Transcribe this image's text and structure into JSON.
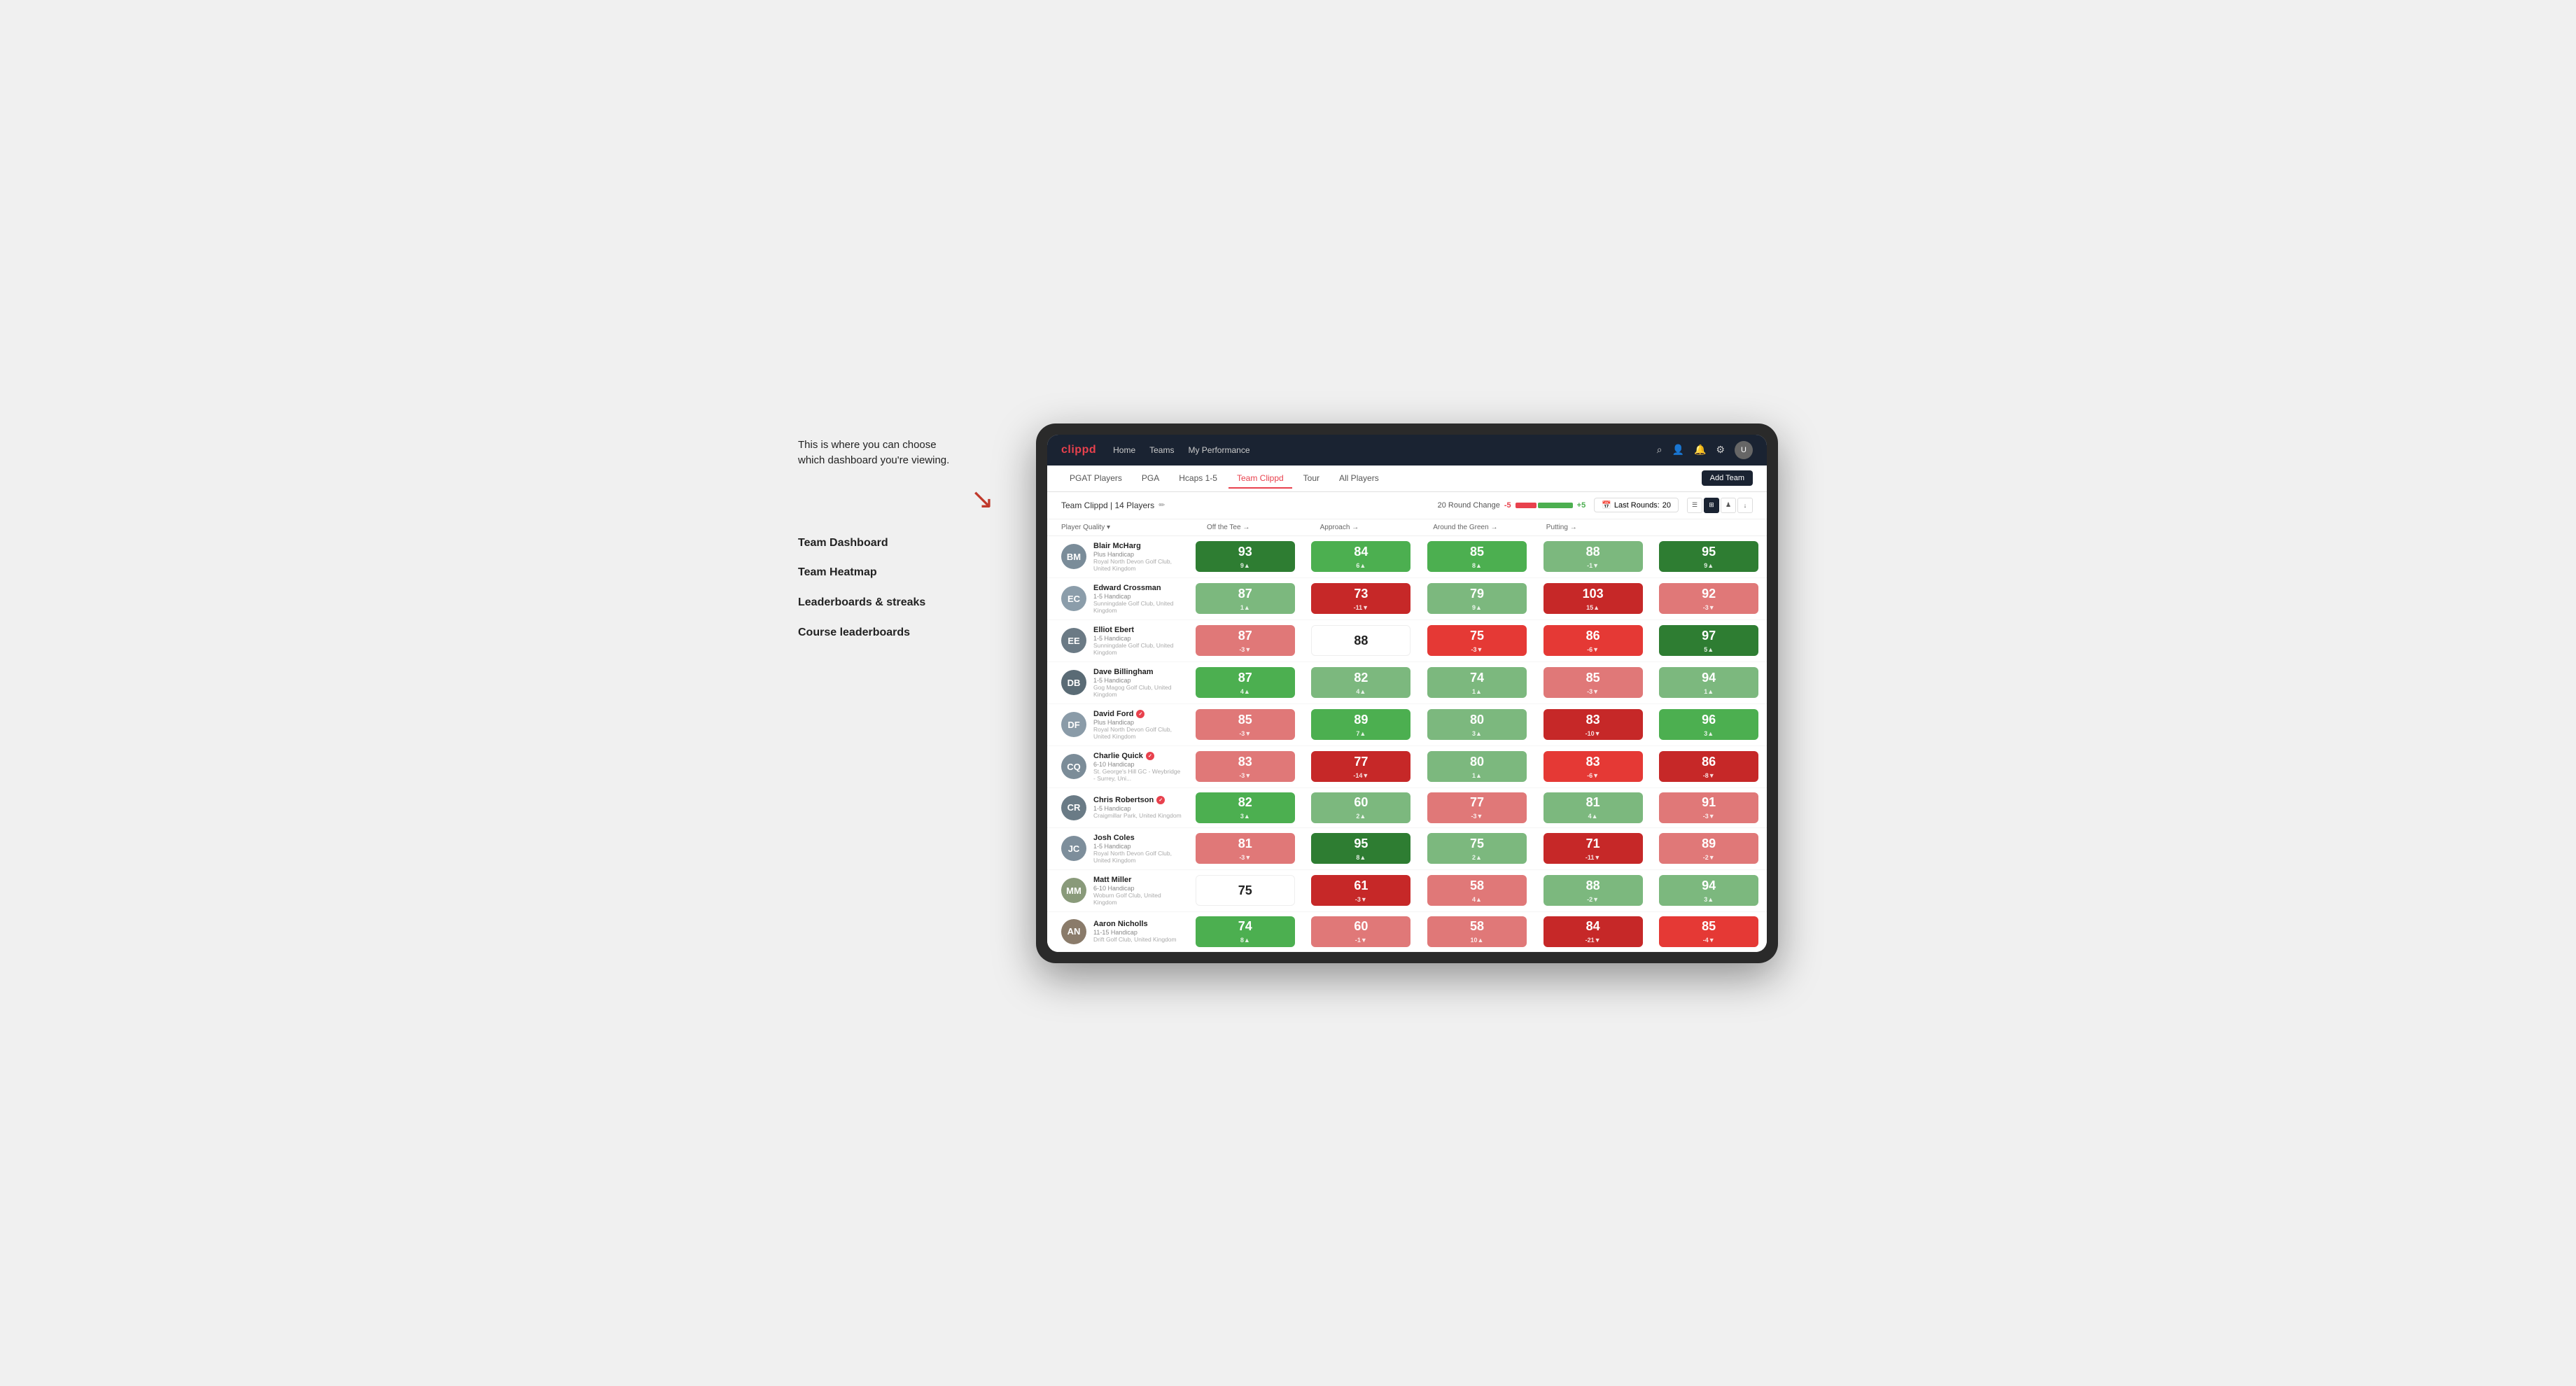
{
  "annotation": {
    "intro": "This is where you can choose which dashboard you're viewing.",
    "items": [
      "Team Dashboard",
      "Team Heatmap",
      "Leaderboards & streaks",
      "Course leaderboards"
    ]
  },
  "nav": {
    "logo": "clippd",
    "links": [
      "Home",
      "Teams",
      "My Performance"
    ],
    "icons": [
      "search",
      "person",
      "bell",
      "settings",
      "avatar"
    ]
  },
  "tabs": {
    "items": [
      "PGAT Players",
      "PGA",
      "Hcaps 1-5",
      "Team Clippd",
      "Tour",
      "All Players"
    ],
    "active": "Team Clippd",
    "add_button": "Add Team"
  },
  "sub_header": {
    "team_name": "Team Clippd | 14 Players",
    "round_change_label": "20 Round Change",
    "change_neg": "-5",
    "change_pos": "+5",
    "last_rounds_label": "Last Rounds:",
    "last_rounds_value": "20"
  },
  "columns": [
    {
      "label": "Player Quality ▾",
      "id": "player-quality"
    },
    {
      "label": "Off the Tee ▾",
      "id": "off-tee"
    },
    {
      "label": "Approach →",
      "id": "approach"
    },
    {
      "label": "Around the Green →",
      "id": "around-green"
    },
    {
      "label": "Putting →",
      "id": "putting"
    }
  ],
  "players": [
    {
      "name": "Blair McHarg",
      "handicap": "Plus Handicap",
      "club": "Royal North Devon Golf Club, United Kingdom",
      "initials": "BM",
      "color": "#7a8c99",
      "scores": [
        {
          "value": "93",
          "change": "9▲",
          "bg": "green-dark"
        },
        {
          "value": "84",
          "change": "6▲",
          "bg": "green-mid"
        },
        {
          "value": "85",
          "change": "8▲",
          "bg": "green-mid"
        },
        {
          "value": "88",
          "change": "-1▼",
          "bg": "green-light"
        },
        {
          "value": "95",
          "change": "9▲",
          "bg": "green-dark"
        }
      ]
    },
    {
      "name": "Edward Crossman",
      "handicap": "1-5 Handicap",
      "club": "Sunningdale Golf Club, United Kingdom",
      "initials": "EC",
      "color": "#8b9daa",
      "scores": [
        {
          "value": "87",
          "change": "1▲",
          "bg": "green-light"
        },
        {
          "value": "73",
          "change": "-11▼",
          "bg": "red-dark"
        },
        {
          "value": "79",
          "change": "9▲",
          "bg": "green-light"
        },
        {
          "value": "103",
          "change": "15▲",
          "bg": "red-dark"
        },
        {
          "value": "92",
          "change": "-3▼",
          "bg": "red-light"
        }
      ]
    },
    {
      "name": "Elliot Ebert",
      "handicap": "1-5 Handicap",
      "club": "Sunningdale Golf Club, United Kingdom",
      "initials": "EE",
      "color": "#6b7a85",
      "scores": [
        {
          "value": "87",
          "change": "-3▼",
          "bg": "red-light"
        },
        {
          "value": "88",
          "change": "",
          "bg": "white"
        },
        {
          "value": "75",
          "change": "-3▼",
          "bg": "red-mid"
        },
        {
          "value": "86",
          "change": "-6▼",
          "bg": "red-mid"
        },
        {
          "value": "97",
          "change": "5▲",
          "bg": "green-dark"
        }
      ]
    },
    {
      "name": "Dave Billingham",
      "handicap": "1-5 Handicap",
      "club": "Gog Magog Golf Club, United Kingdom",
      "initials": "DB",
      "color": "#5a6b75",
      "scores": [
        {
          "value": "87",
          "change": "4▲",
          "bg": "green-mid"
        },
        {
          "value": "82",
          "change": "4▲",
          "bg": "green-light"
        },
        {
          "value": "74",
          "change": "1▲",
          "bg": "green-light"
        },
        {
          "value": "85",
          "change": "-3▼",
          "bg": "red-light"
        },
        {
          "value": "94",
          "change": "1▲",
          "bg": "green-light"
        }
      ]
    },
    {
      "name": "David Ford",
      "handicap": "Plus Handicap",
      "club": "Royal North Devon Golf Club, United Kingdom",
      "initials": "DF",
      "badge": true,
      "color": "#8a9ba8",
      "scores": [
        {
          "value": "85",
          "change": "-3▼",
          "bg": "red-light"
        },
        {
          "value": "89",
          "change": "7▲",
          "bg": "green-mid"
        },
        {
          "value": "80",
          "change": "3▲",
          "bg": "green-light"
        },
        {
          "value": "83",
          "change": "-10▼",
          "bg": "red-dark"
        },
        {
          "value": "96",
          "change": "3▲",
          "bg": "green-mid"
        }
      ]
    },
    {
      "name": "Charlie Quick",
      "handicap": "6-10 Handicap",
      "club": "St. George's Hill GC - Weybridge - Surrey, Uni...",
      "initials": "CQ",
      "badge": true,
      "color": "#7b8c98",
      "scores": [
        {
          "value": "83",
          "change": "-3▼",
          "bg": "red-light"
        },
        {
          "value": "77",
          "change": "-14▼",
          "bg": "red-dark"
        },
        {
          "value": "80",
          "change": "1▲",
          "bg": "green-light"
        },
        {
          "value": "83",
          "change": "-6▼",
          "bg": "red-mid"
        },
        {
          "value": "86",
          "change": "-8▼",
          "bg": "red-dark"
        }
      ]
    },
    {
      "name": "Chris Robertson",
      "handicap": "1-5 Handicap",
      "club": "Craigmillar Park, United Kingdom",
      "initials": "CR",
      "badge": true,
      "color": "#6a7b86",
      "scores": [
        {
          "value": "82",
          "change": "3▲",
          "bg": "green-mid"
        },
        {
          "value": "60",
          "change": "2▲",
          "bg": "green-light"
        },
        {
          "value": "77",
          "change": "-3▼",
          "bg": "red-light"
        },
        {
          "value": "81",
          "change": "4▲",
          "bg": "green-light"
        },
        {
          "value": "91",
          "change": "-3▼",
          "bg": "red-light"
        }
      ]
    },
    {
      "name": "Josh Coles",
      "handicap": "1-5 Handicap",
      "club": "Royal North Devon Golf Club, United Kingdom",
      "initials": "JC",
      "color": "#7d8e9b",
      "scores": [
        {
          "value": "81",
          "change": "-3▼",
          "bg": "red-light"
        },
        {
          "value": "95",
          "change": "8▲",
          "bg": "green-dark"
        },
        {
          "value": "75",
          "change": "2▲",
          "bg": "green-light"
        },
        {
          "value": "71",
          "change": "-11▼",
          "bg": "red-dark"
        },
        {
          "value": "89",
          "change": "-2▼",
          "bg": "red-light"
        }
      ]
    },
    {
      "name": "Matt Miller",
      "handicap": "6-10 Handicap",
      "club": "Woburn Golf Club, United Kingdom",
      "initials": "MM",
      "color": "#899a7a",
      "scores": [
        {
          "value": "75",
          "change": "",
          "bg": "white"
        },
        {
          "value": "61",
          "change": "-3▼",
          "bg": "red-dark"
        },
        {
          "value": "58",
          "change": "4▲",
          "bg": "red-light"
        },
        {
          "value": "88",
          "change": "-2▼",
          "bg": "green-light"
        },
        {
          "value": "94",
          "change": "3▲",
          "bg": "green-light"
        }
      ]
    },
    {
      "name": "Aaron Nicholls",
      "handicap": "11-15 Handicap",
      "club": "Drift Golf Club, United Kingdom",
      "initials": "AN",
      "color": "#8a7b6a",
      "scores": [
        {
          "value": "74",
          "change": "8▲",
          "bg": "green-mid"
        },
        {
          "value": "60",
          "change": "-1▼",
          "bg": "red-light"
        },
        {
          "value": "58",
          "change": "10▲",
          "bg": "red-light"
        },
        {
          "value": "84",
          "change": "-21▼",
          "bg": "red-dark"
        },
        {
          "value": "85",
          "change": "-4▼",
          "bg": "red-mid"
        }
      ]
    }
  ],
  "colors": {
    "green_dark": "#2e7d32",
    "green_mid": "#4caf50",
    "green_light": "#81c784",
    "red_dark": "#c62828",
    "red_mid": "#e53935",
    "red_light": "#ef9a9a",
    "white": "#ffffff",
    "nav_bg": "#1a2332",
    "brand_red": "#e8414d"
  }
}
